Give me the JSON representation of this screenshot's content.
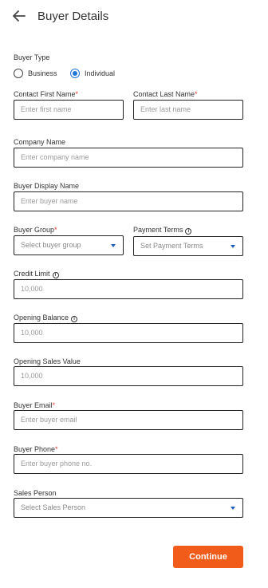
{
  "header": {
    "title": "Buyer Details"
  },
  "buyer_type": {
    "label": "Buyer Type",
    "options": [
      "Business",
      "Individual"
    ],
    "selected": "Individual"
  },
  "fields": {
    "first_name": {
      "label": "Contact First Name",
      "required_mark": "*",
      "placeholder": "Enter first name"
    },
    "last_name": {
      "label": "Contact Last Name",
      "required_mark": "*",
      "placeholder": "Enter last name"
    },
    "company_name": {
      "label": "Company Name",
      "placeholder": "Enter company name"
    },
    "display_name": {
      "label": "Buyer Display Name",
      "placeholder": "Enter buyer name"
    },
    "buyer_group": {
      "label": "Buyer Group",
      "required_mark": "*",
      "placeholder": "Select buyer group"
    },
    "payment_terms": {
      "label": "Payment Terms",
      "placeholder": "Set Payment Terms",
      "info_icon": "info-icon"
    },
    "credit_limit": {
      "label": "Credit Limit",
      "placeholder": "10,000",
      "info_icon": "info-icon"
    },
    "opening_balance": {
      "label": "Opening Balance",
      "placeholder": "10,000",
      "info_icon": "info-icon"
    },
    "opening_sales_value": {
      "label": "Opening Sales Value",
      "placeholder": "10,000"
    },
    "buyer_email": {
      "label": "Buyer Email",
      "required_mark": "*",
      "placeholder": "Enter buyer email"
    },
    "buyer_phone": {
      "label": "Buyer Phone",
      "required_mark": "*",
      "placeholder": "Enter buyer phone no."
    },
    "sales_person": {
      "label": "Sales Person",
      "placeholder": "Select Sales Person"
    }
  },
  "actions": {
    "continue_label": "Continue"
  },
  "colors": {
    "accent": "#f25c1a",
    "radio": "#1f75d8",
    "required": "#e53935"
  }
}
